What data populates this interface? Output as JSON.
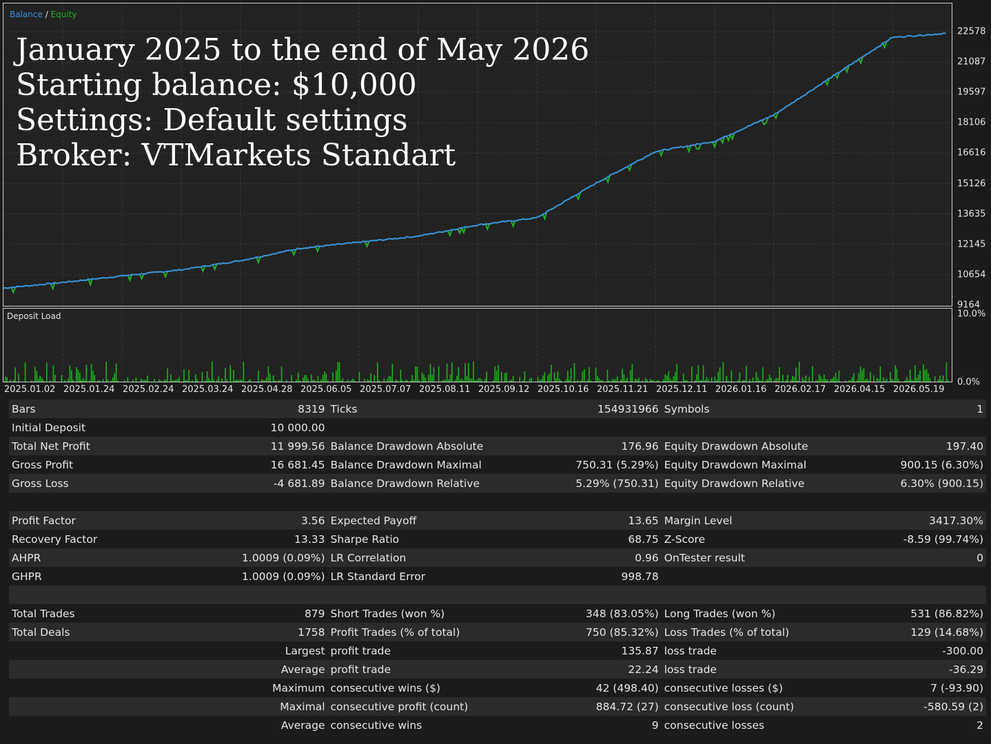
{
  "legend": {
    "balance": "Balance",
    "separator": "/",
    "equity": "Equity"
  },
  "overlay_lines": [
    "January 2025 to the end of May 2026",
    "Starting balance: $10,000",
    "Settings: Default settings",
    "Broker: VTMarkets Standart"
  ],
  "colors": {
    "balance": "#3a8fe0",
    "equity": "#22b022",
    "background": "#222222",
    "grid": "#3a3a3a",
    "load_bar": "#17b817"
  },
  "chart_data": [
    {
      "type": "line",
      "title": "",
      "series": [
        {
          "name": "Balance",
          "color": "#3a8fe0"
        },
        {
          "name": "Equity",
          "color": "#22b022"
        }
      ],
      "yticks": [
        "22578",
        "21087",
        "19597",
        "18106",
        "16616",
        "15126",
        "13635",
        "12145",
        "10654",
        "9164"
      ],
      "ylim": [
        9164,
        22578
      ],
      "x": [
        "2025.01.02",
        "2025.01.24",
        "2025.02.24",
        "2025.03.24",
        "2025.04.28",
        "2025.06.05",
        "2025.07.07",
        "2025.08.11",
        "2025.09.12",
        "2025.10.16",
        "2025.11.21",
        "2025.12.11",
        "2026.01.16",
        "2026.02.17",
        "2026.04.15",
        "2026.05.19"
      ],
      "values": [
        10000,
        10280,
        10600,
        10900,
        11350,
        11950,
        12250,
        12550,
        13100,
        13450,
        15150,
        16700,
        17200,
        18500,
        20400,
        22300
      ],
      "grid": true
    },
    {
      "type": "bar",
      "title": "Deposit Load",
      "yticks": [
        "10.0%",
        "0.0%"
      ],
      "ylim": [
        0,
        10
      ],
      "grid": true
    }
  ],
  "stats": {
    "rows": [
      [
        "Bars",
        "8319",
        "Ticks",
        "154931966",
        "Symbols",
        "1"
      ],
      [
        "Initial Deposit",
        "10 000.00",
        "",
        "",
        "",
        ""
      ],
      [
        "Total Net Profit",
        "11 999.56",
        "Balance Drawdown Absolute",
        "176.96",
        "Equity Drawdown Absolute",
        "197.40"
      ],
      [
        "Gross Profit",
        "16 681.45",
        "Balance Drawdown Maximal",
        "750.31 (5.29%)",
        "Equity Drawdown Maximal",
        "900.15 (6.30%)"
      ],
      [
        "Gross Loss",
        "-4 681.89",
        "Balance Drawdown Relative",
        "5.29% (750.31)",
        "Equity Drawdown Relative",
        "6.30% (900.15)"
      ],
      [
        "",
        "",
        "",
        "",
        "",
        ""
      ],
      [
        "Profit Factor",
        "3.56",
        "Expected Payoff",
        "13.65",
        "Margin Level",
        "3417.30%"
      ],
      [
        "Recovery Factor",
        "13.33",
        "Sharpe Ratio",
        "68.75",
        "Z-Score",
        "-8.59 (99.74%)"
      ],
      [
        "AHPR",
        "1.0009 (0.09%)",
        "LR Correlation",
        "0.96",
        "OnTester result",
        "0"
      ],
      [
        "GHPR",
        "1.0009 (0.09%)",
        "LR Standard Error",
        "998.78",
        "",
        ""
      ],
      [
        "",
        "",
        "",
        "",
        "",
        ""
      ],
      [
        "Total Trades",
        "879",
        "Short Trades (won %)",
        "348 (83.05%)",
        "Long Trades (won %)",
        "531 (86.82%)"
      ],
      [
        "Total Deals",
        "1758",
        "Profit Trades (% of total)",
        "750 (85.32%)",
        "Loss Trades (% of total)",
        "129 (14.68%)"
      ],
      [
        "",
        "Largest",
        "profit trade",
        "135.87",
        "loss trade",
        "-300.00"
      ],
      [
        "",
        "Average",
        "profit trade",
        "22.24",
        "loss trade",
        "-36.29"
      ],
      [
        "",
        "Maximum",
        "consecutive wins ($)",
        "42 (498.40)",
        "consecutive losses ($)",
        "7 (-93.90)"
      ],
      [
        "",
        "Maximal",
        "consecutive profit (count)",
        "884.72 (27)",
        "consecutive loss (count)",
        "-580.59 (2)"
      ],
      [
        "",
        "Average",
        "consecutive wins",
        "9",
        "consecutive losses",
        "2"
      ]
    ]
  }
}
